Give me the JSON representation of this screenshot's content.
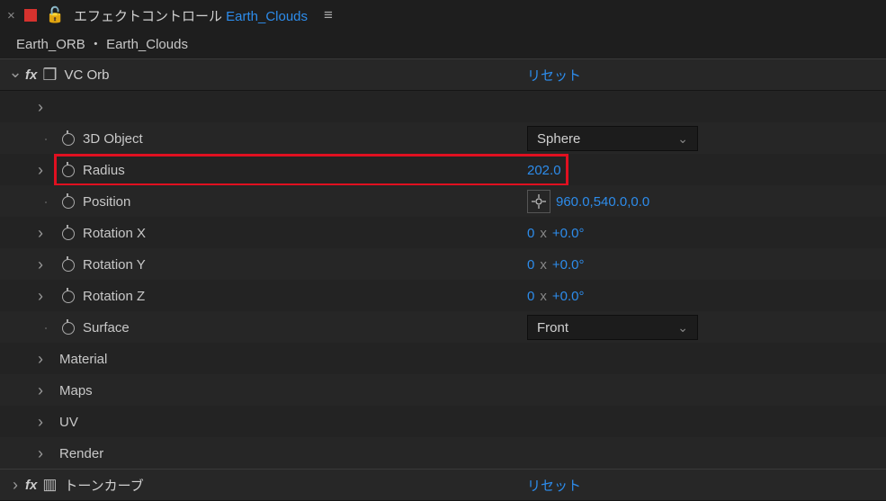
{
  "header": {
    "panel_title": "エフェクトコントロール",
    "layer_name": "Earth_Clouds"
  },
  "breadcrumb": {
    "comp": "Earth_ORB",
    "sep": "・",
    "layer": "Earth_Clouds"
  },
  "effect1": {
    "name": "VC Orb",
    "reset": "リセット",
    "props": {
      "obj3d_label": "3D Object",
      "obj3d_value": "Sphere",
      "radius_label": "Radius",
      "radius_value": "202.0",
      "position_label": "Position",
      "position_value": "960.0,540.0,0.0",
      "rotx_label": "Rotation X",
      "rotx_rev": "0",
      "rotx_x": "x",
      "rotx_deg": "+0.0°",
      "roty_label": "Rotation Y",
      "roty_rev": "0",
      "roty_x": "x",
      "roty_deg": "+0.0°",
      "rotz_label": "Rotation Z",
      "rotz_rev": "0",
      "rotz_x": "x",
      "rotz_deg": "+0.0°",
      "surface_label": "Surface",
      "surface_value": "Front"
    },
    "groups": {
      "material": "Material",
      "maps": "Maps",
      "uv": "UV",
      "render": "Render"
    }
  },
  "effect2": {
    "name": "トーンカーブ",
    "reset": "リセット"
  }
}
